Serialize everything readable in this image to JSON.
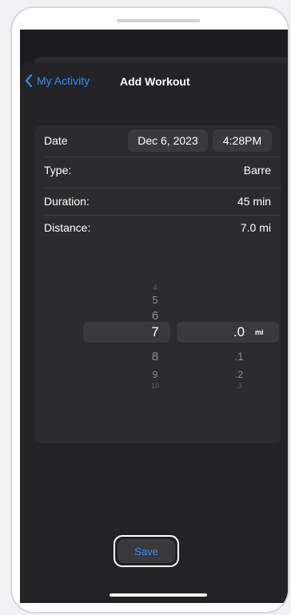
{
  "nav": {
    "back_label": "My Activity",
    "title": "Add Workout"
  },
  "form": {
    "date_label": "Date",
    "date_value": "Dec 6, 2023",
    "time_value": "4:28PM",
    "type_label": "Type:",
    "type_value": "Barre",
    "duration_label": "Duration:",
    "duration_value": "45 min",
    "distance_label": "Distance:",
    "distance_value": "7.0 mi"
  },
  "picker": {
    "whole": {
      "above": [
        "4",
        "5",
        "6"
      ],
      "selected": "7",
      "below": [
        "8",
        "9",
        "10"
      ]
    },
    "decimal": {
      "selected": ".0",
      "below": [
        ".1",
        ".2",
        ".3"
      ]
    },
    "unit": "mi"
  },
  "actions": {
    "save_label": "Save"
  },
  "colors": {
    "accent": "#2f8ff5",
    "background": "#1c1c1e",
    "card": "#2c2c2e"
  }
}
